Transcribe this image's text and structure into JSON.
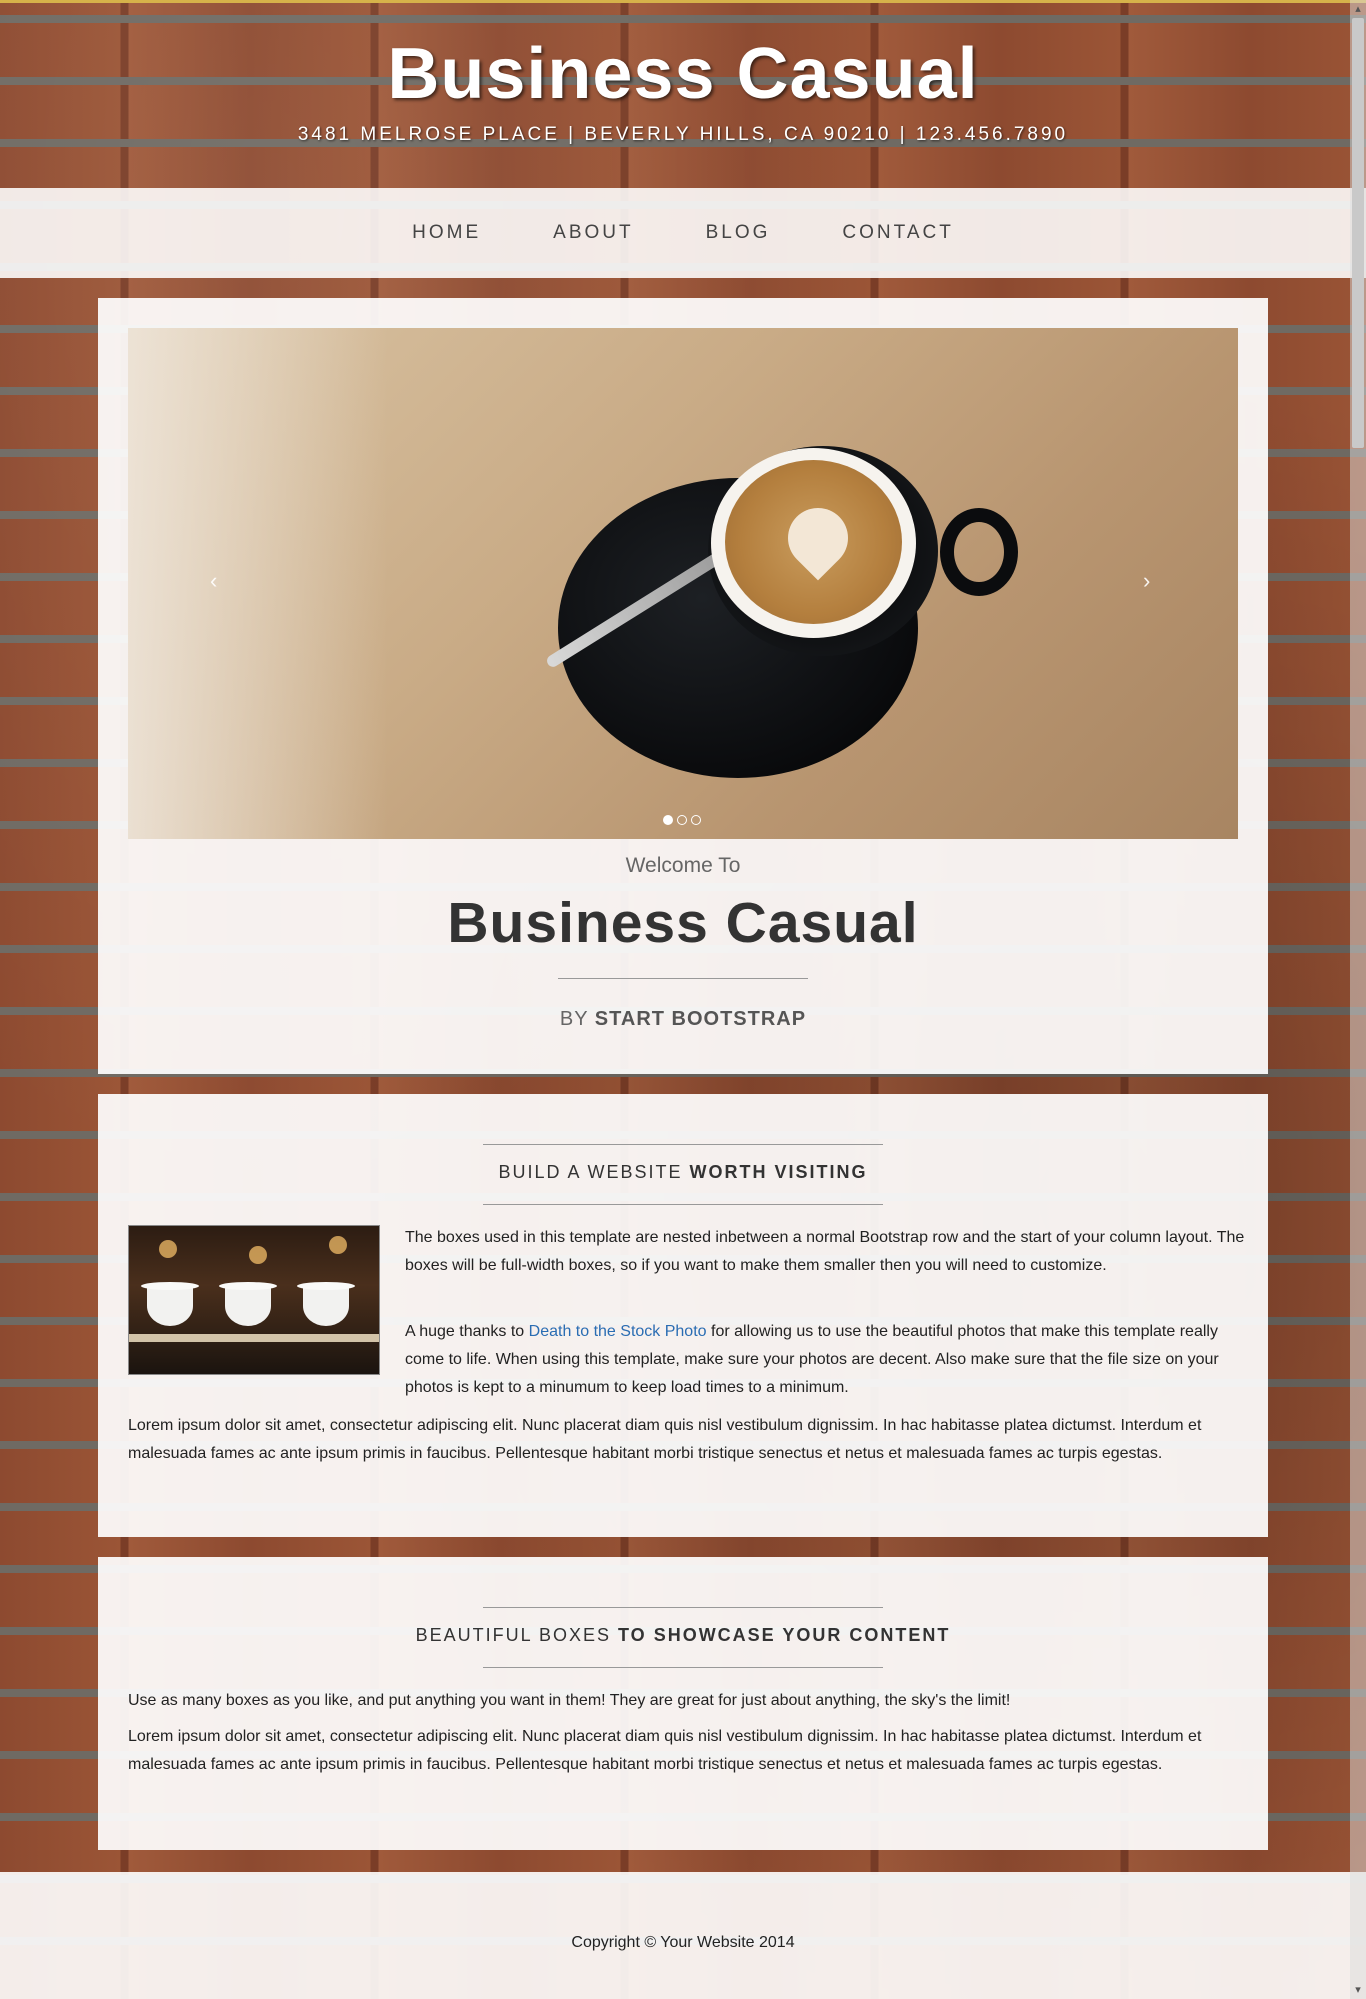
{
  "header": {
    "brand": "Business Casual",
    "address": "3481 MELROSE PLACE | BEVERLY HILLS, CA 90210 | 123.456.7890"
  },
  "nav": {
    "items": [
      {
        "label": "HOME"
      },
      {
        "label": "ABOUT"
      },
      {
        "label": "BLOG"
      },
      {
        "label": "CONTACT"
      }
    ]
  },
  "carousel": {
    "prev_icon": "‹",
    "next_icon": "›",
    "slides": 3,
    "active_slide": 1
  },
  "intro": {
    "welcome": "Welcome To",
    "title": "Business Casual",
    "by": "BY",
    "author": "START BOOTSTRAP"
  },
  "section1": {
    "title_light": "BUILD A WEBSITE ",
    "title_bold": "WORTH VISITING",
    "para1": "The boxes used in this template are nested inbetween a normal Bootstrap row and the start of your column layout. The boxes will be full-width boxes, so if you want to make them smaller then you will need to customize.",
    "para2_before": "A huge thanks to ",
    "para2_link": "Death to the Stock Photo",
    "para2_after": " for allowing us to use the beautiful photos that make this template really come to life. When using this template, make sure your photos are decent. Also make sure that the file size on your photos is kept to a minumum to keep load times to a minimum.",
    "para3": "Lorem ipsum dolor sit amet, consectetur adipiscing elit. Nunc placerat diam quis nisl vestibulum dignissim. In hac habitasse platea dictumst. Interdum et malesuada fames ac ante ipsum primis in faucibus. Pellentesque habitant morbi tristique senectus et netus et malesuada fames ac turpis egestas."
  },
  "section2": {
    "title_light": "BEAUTIFUL BOXES ",
    "title_bold": "TO SHOWCASE YOUR CONTENT",
    "para1": "Use as many boxes as you like, and put anything you want in them! They are great for just about anything, the sky's the limit!",
    "para2": "Lorem ipsum dolor sit amet, consectetur adipiscing elit. Nunc placerat diam quis nisl vestibulum dignissim. In hac habitasse platea dictumst. Interdum et malesuada fames ac ante ipsum primis in faucibus. Pellentesque habitant morbi tristique senectus et netus et malesuada fames ac turpis egestas."
  },
  "footer": {
    "copyright": "Copyright © Your Website 2014"
  }
}
